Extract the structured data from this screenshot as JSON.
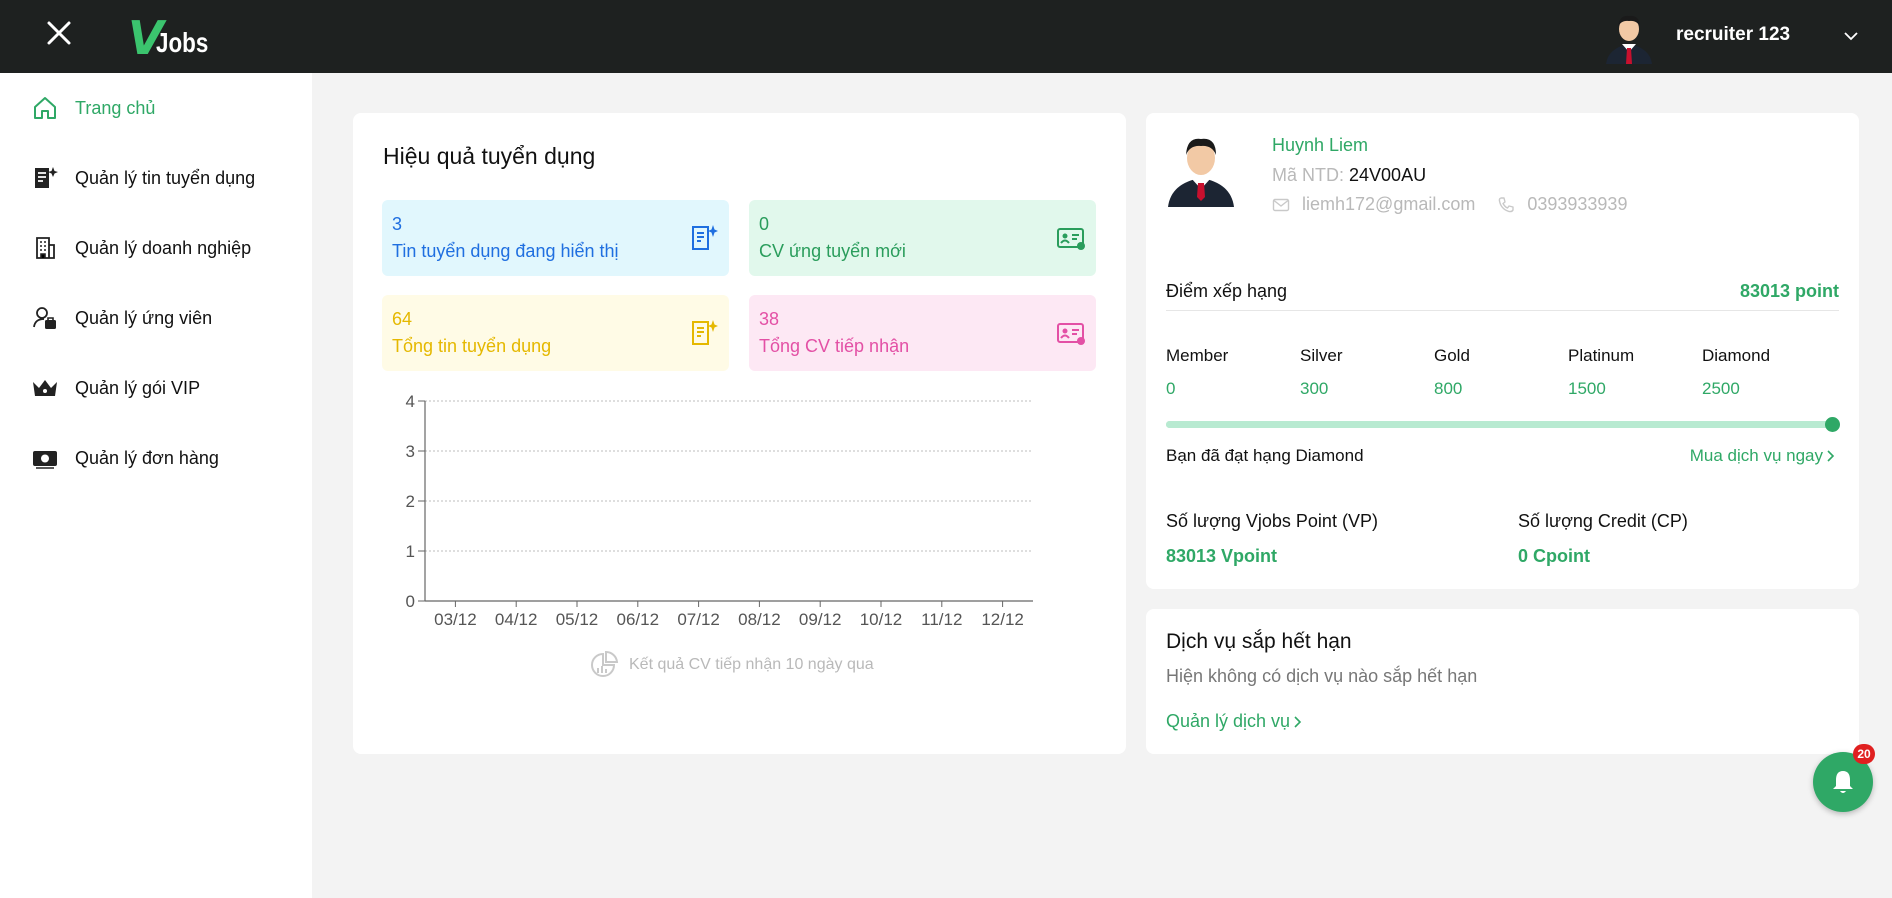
{
  "header": {
    "logo": {
      "mark": "V",
      "text": "Jobs"
    },
    "user_name": "recruiter 123"
  },
  "sidebar": {
    "items": [
      {
        "label": "Trang chủ",
        "icon": "home-icon",
        "active": true
      },
      {
        "label": "Quản lý tin tuyển dụng",
        "icon": "job-post-icon"
      },
      {
        "label": "Quản lý doanh nghiệp",
        "icon": "building-icon"
      },
      {
        "label": "Quản lý ứng viên",
        "icon": "candidate-icon"
      },
      {
        "label": "Quản lý gói VIP",
        "icon": "crown-icon"
      },
      {
        "label": "Quản lý đơn hàng",
        "icon": "money-icon"
      }
    ]
  },
  "performance": {
    "title": "Hiệu quả tuyển dụng",
    "stats": [
      {
        "value": "3",
        "label": "Tin tuyển dụng đang hiển thị",
        "color": "#1f6fe0"
      },
      {
        "value": "0",
        "label": "CV ứng tuyển mới",
        "color": "#2a9d5c"
      },
      {
        "value": "64",
        "label": "Tổng tin tuyển dụng",
        "color": "#e5b800"
      },
      {
        "value": "38",
        "label": "Tổng CV tiếp nhận",
        "color": "#e350a5"
      }
    ],
    "chart_caption": "Kết quả CV tiếp nhận 10 ngày qua"
  },
  "chart_data": {
    "type": "line",
    "categories": [
      "03/12",
      "04/12",
      "05/12",
      "06/12",
      "07/12",
      "08/12",
      "09/12",
      "10/12",
      "11/12",
      "12/12"
    ],
    "values": [
      0,
      0,
      0,
      0,
      0,
      0,
      0,
      0,
      0,
      0
    ],
    "yticks": [
      "0",
      "1",
      "2",
      "3",
      "4"
    ],
    "ylim": [
      0,
      4
    ],
    "grid": true
  },
  "profile": {
    "name": "Huynh Liem",
    "code_label": "Mã NTD:",
    "code": "24V00AU",
    "email": "liemh172@gmail.com",
    "phone": "0393933939",
    "rank_label": "Điểm xếp hạng",
    "rank_points": "83013 point",
    "tiers": [
      {
        "name": "Member",
        "value": "0"
      },
      {
        "name": "Silver",
        "value": "300"
      },
      {
        "name": "Gold",
        "value": "800"
      },
      {
        "name": "Platinum",
        "value": "1500"
      },
      {
        "name": "Diamond",
        "value": "2500"
      }
    ],
    "progress_percent": 100,
    "achieved": "Bạn đã đạt hạng Diamond",
    "buy_link": "Mua dịch vụ ngay",
    "vp_label": "Số lượng Vjobs Point (VP)",
    "vp_value": "83013 Vpoint",
    "cp_label": "Số lượng Credit (CP)",
    "cp_value": "0 Cpoint"
  },
  "expiring": {
    "title": "Dịch vụ sắp hết hạn",
    "text": "Hiện không có dịch vụ nào sắp hết hạn",
    "link": "Quản lý dịch vụ"
  },
  "notifications": {
    "count": "20"
  },
  "colors": {
    "accent": "#2fa866",
    "topbar": "#1e2120"
  }
}
